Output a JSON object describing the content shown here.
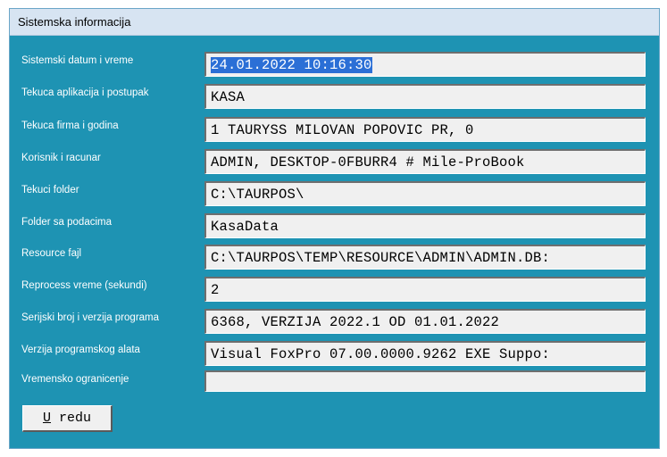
{
  "window": {
    "title": "Sistemska informacija"
  },
  "fields": [
    {
      "label": "Sistemski datum i vreme",
      "value": "24.01.2022 10:16:30",
      "selected": true
    },
    {
      "label": "Tekuca aplikacija i postupak",
      "value": "KASA"
    },
    {
      "label": "Tekuca firma i godina",
      "value": "1 TAURYSS MILOVAN POPOVIC PR, 0"
    },
    {
      "label": "Korisnik i racunar",
      "value": "ADMIN, DESKTOP-0FBURR4 # Mile-ProBook"
    },
    {
      "label": "Tekuci folder",
      "value": "C:\\TAURPOS\\"
    },
    {
      "label": "Folder sa podacima",
      "value": "KasaData"
    },
    {
      "label": "Resource fajl",
      "value": "C:\\TAURPOS\\TEMP\\RESOURCE\\ADMIN\\ADMIN.DB:"
    },
    {
      "label": "Reprocess vreme (sekundi)",
      "value": "2"
    },
    {
      "label": "Serijski broj i verzija programa",
      "value": "6368, VERZIJA 2022.1 OD 01.01.2022"
    },
    {
      "label": "Verzija programskog alata",
      "value": "Visual FoxPro 07.00.0000.9262 EXE Suppo:"
    },
    {
      "label": "Vremensko ogranicenje",
      "value": ""
    }
  ],
  "buttons": {
    "ok_mnemonic": "U",
    "ok_rest": " redu"
  },
  "colors": {
    "background": "#1e93b3",
    "titlebar": "#d7e4f2",
    "field": "#f0f0f0",
    "selection": "#2b6fd6"
  }
}
